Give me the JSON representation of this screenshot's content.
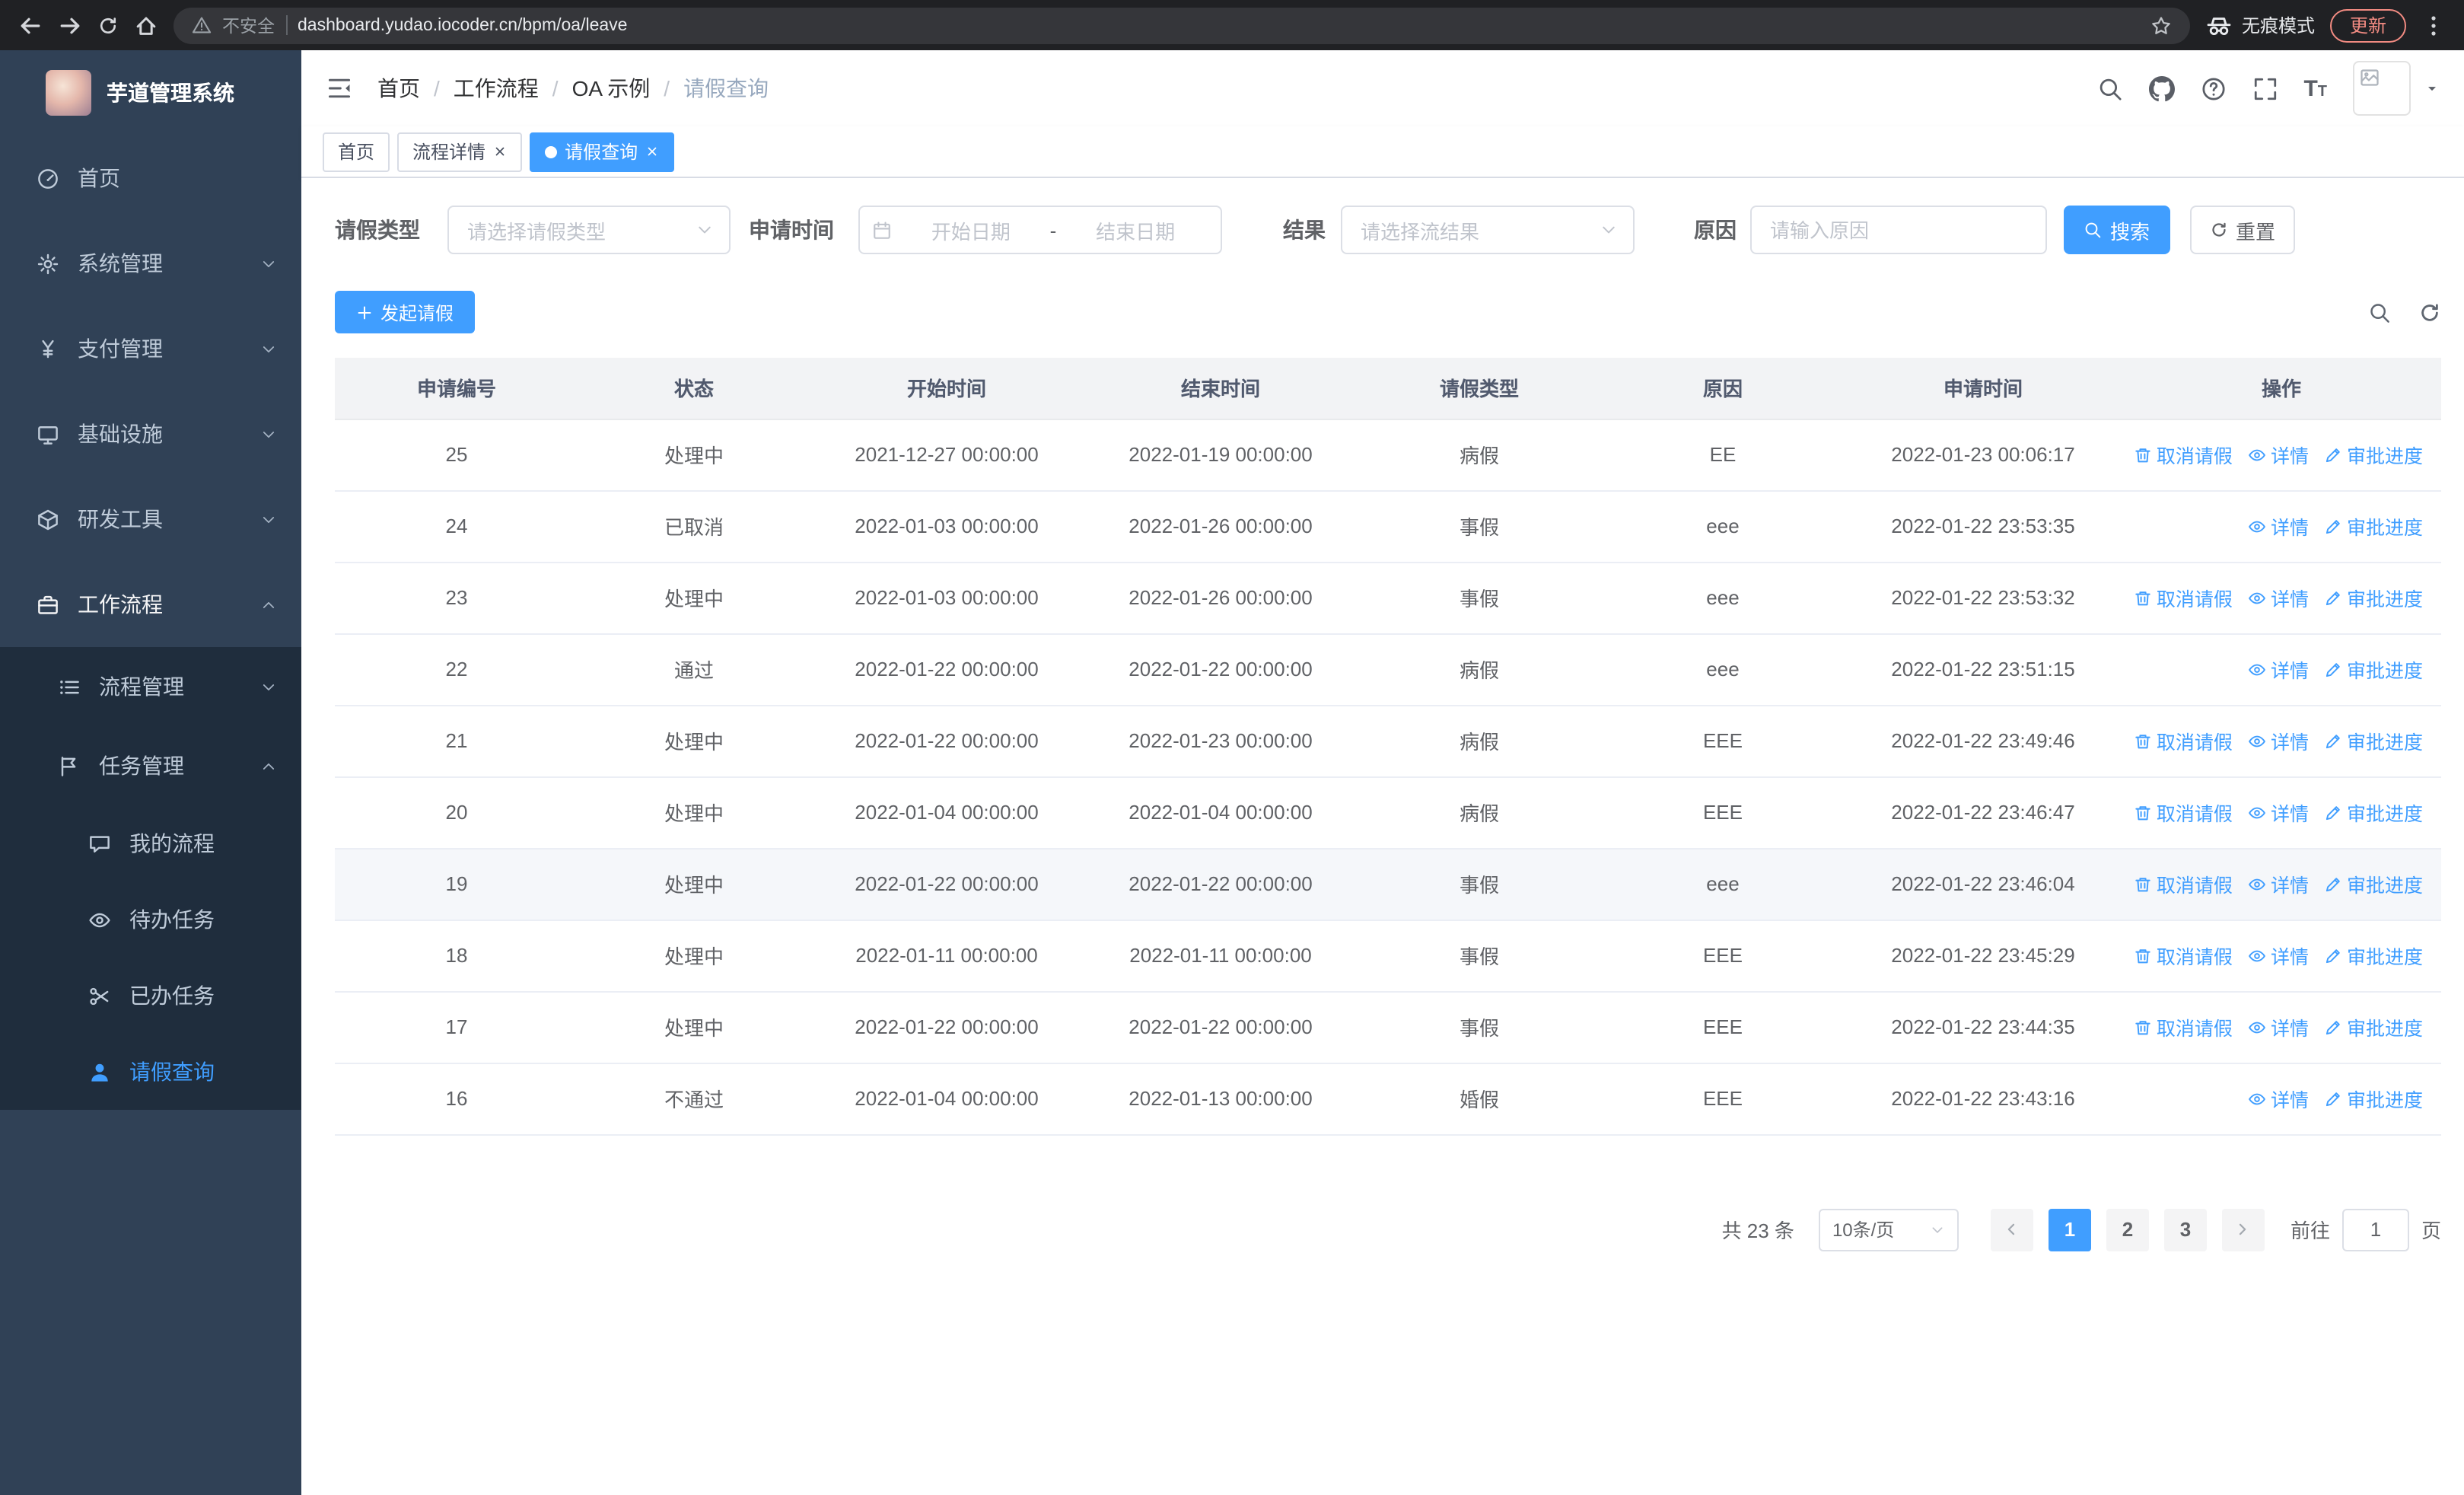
{
  "colors": {
    "accent": "#409eff",
    "sidebar_bg": "#304156",
    "submenu_bg": "#1f2d3d"
  },
  "browser": {
    "security_label": "不安全",
    "url": "dashboard.yudao.iocoder.cn/bpm/oa/leave",
    "incognito_label": "无痕模式",
    "update_label": "更新"
  },
  "sidebar": {
    "logo_title": "芋道管理系统",
    "items": [
      {
        "key": "home",
        "label": "首页",
        "icon": "dashboard",
        "level": 1
      },
      {
        "key": "system",
        "label": "系统管理",
        "icon": "gear",
        "level": 1,
        "chevron": "down"
      },
      {
        "key": "payment",
        "label": "支付管理",
        "icon": "yen",
        "level": 1,
        "chevron": "down"
      },
      {
        "key": "infrastructure",
        "label": "基础设施",
        "icon": "monitor",
        "level": 1,
        "chevron": "down"
      },
      {
        "key": "devtools",
        "label": "研发工具",
        "icon": "cube",
        "level": 1,
        "chevron": "down"
      },
      {
        "key": "workflow",
        "label": "工作流程",
        "icon": "briefcase",
        "level": 1,
        "chevron": "up",
        "open": true
      },
      {
        "key": "process-mgmt",
        "label": "流程管理",
        "icon": "list",
        "level": 2,
        "chevron": "down"
      },
      {
        "key": "task-mgmt",
        "label": "任务管理",
        "icon": "flag",
        "level": 2,
        "chevron": "up",
        "open": true
      },
      {
        "key": "my-process",
        "label": "我的流程",
        "icon": "chat",
        "level": 3
      },
      {
        "key": "todo-task",
        "label": "待办任务",
        "icon": "eye",
        "level": 3
      },
      {
        "key": "done-task",
        "label": "已办任务",
        "icon": "scissors",
        "level": 3
      },
      {
        "key": "leave-query",
        "label": "请假查询",
        "icon": "user",
        "level": 3,
        "active": true
      }
    ]
  },
  "header": {
    "breadcrumb": [
      "首页",
      "工作流程",
      "OA 示例",
      "请假查询"
    ]
  },
  "tabs": [
    {
      "key": "home",
      "label": "首页",
      "closable": false,
      "active": false
    },
    {
      "key": "process-detail",
      "label": "流程详情",
      "closable": true,
      "active": false
    },
    {
      "key": "leave-query",
      "label": "请假查询",
      "closable": true,
      "active": true
    }
  ],
  "filters": {
    "leave_type_label": "请假类型",
    "leave_type_placeholder": "请选择请假类型",
    "apply_time_label": "申请时间",
    "start_placeholder": "开始日期",
    "range_separator": "-",
    "end_placeholder": "结束日期",
    "result_label": "结果",
    "result_placeholder": "请选择流结果",
    "reason_label": "原因",
    "reason_placeholder": "请输入原因",
    "search_label": "搜索",
    "reset_label": "重置"
  },
  "toolbar": {
    "create_label": "发起请假"
  },
  "table": {
    "columns": [
      "申请编号",
      "状态",
      "开始时间",
      "结束时间",
      "请假类型",
      "原因",
      "申请时间",
      "操作"
    ],
    "action_labels": {
      "cancel": "取消请假",
      "detail": "详情",
      "progress": "审批进度"
    },
    "rows": [
      {
        "id": "25",
        "status": "处理中",
        "start": "2021-12-27 00:00:00",
        "end": "2022-01-19 00:00:00",
        "type": "病假",
        "reason": "EE",
        "applied": "2022-01-23 00:06:17",
        "actions": [
          "cancel",
          "detail",
          "progress"
        ]
      },
      {
        "id": "24",
        "status": "已取消",
        "start": "2022-01-03 00:00:00",
        "end": "2022-01-26 00:00:00",
        "type": "事假",
        "reason": "eee",
        "applied": "2022-01-22 23:53:35",
        "actions": [
          "detail",
          "progress"
        ]
      },
      {
        "id": "23",
        "status": "处理中",
        "start": "2022-01-03 00:00:00",
        "end": "2022-01-26 00:00:00",
        "type": "事假",
        "reason": "eee",
        "applied": "2022-01-22 23:53:32",
        "actions": [
          "cancel",
          "detail",
          "progress"
        ]
      },
      {
        "id": "22",
        "status": "通过",
        "start": "2022-01-22 00:00:00",
        "end": "2022-01-22 00:00:00",
        "type": "病假",
        "reason": "eee",
        "applied": "2022-01-22 23:51:15",
        "actions": [
          "detail",
          "progress"
        ]
      },
      {
        "id": "21",
        "status": "处理中",
        "start": "2022-01-22 00:00:00",
        "end": "2022-01-23 00:00:00",
        "type": "病假",
        "reason": "EEE",
        "applied": "2022-01-22 23:49:46",
        "actions": [
          "cancel",
          "detail",
          "progress"
        ]
      },
      {
        "id": "20",
        "status": "处理中",
        "start": "2022-01-04 00:00:00",
        "end": "2022-01-04 00:00:00",
        "type": "病假",
        "reason": "EEE",
        "applied": "2022-01-22 23:46:47",
        "actions": [
          "cancel",
          "detail",
          "progress"
        ]
      },
      {
        "id": "19",
        "status": "处理中",
        "start": "2022-01-22 00:00:00",
        "end": "2022-01-22 00:00:00",
        "type": "事假",
        "reason": "eee",
        "applied": "2022-01-22 23:46:04",
        "actions": [
          "cancel",
          "detail",
          "progress"
        ],
        "highlighted": true
      },
      {
        "id": "18",
        "status": "处理中",
        "start": "2022-01-11 00:00:00",
        "end": "2022-01-11 00:00:00",
        "type": "事假",
        "reason": "EEE",
        "applied": "2022-01-22 23:45:29",
        "actions": [
          "cancel",
          "detail",
          "progress"
        ]
      },
      {
        "id": "17",
        "status": "处理中",
        "start": "2022-01-22 00:00:00",
        "end": "2022-01-22 00:00:00",
        "type": "事假",
        "reason": "EEE",
        "applied": "2022-01-22 23:44:35",
        "actions": [
          "cancel",
          "detail",
          "progress"
        ]
      },
      {
        "id": "16",
        "status": "不通过",
        "start": "2022-01-04 00:00:00",
        "end": "2022-01-13 00:00:00",
        "type": "婚假",
        "reason": "EEE",
        "applied": "2022-01-22 23:43:16",
        "actions": [
          "detail",
          "progress"
        ]
      }
    ]
  },
  "pagination": {
    "total_text": "共 23 条",
    "page_size": "10条/页",
    "pages": [
      "1",
      "2",
      "3"
    ],
    "active_page": "1",
    "goto_label": "前往",
    "goto_value": "1",
    "goto_suffix": "页"
  }
}
